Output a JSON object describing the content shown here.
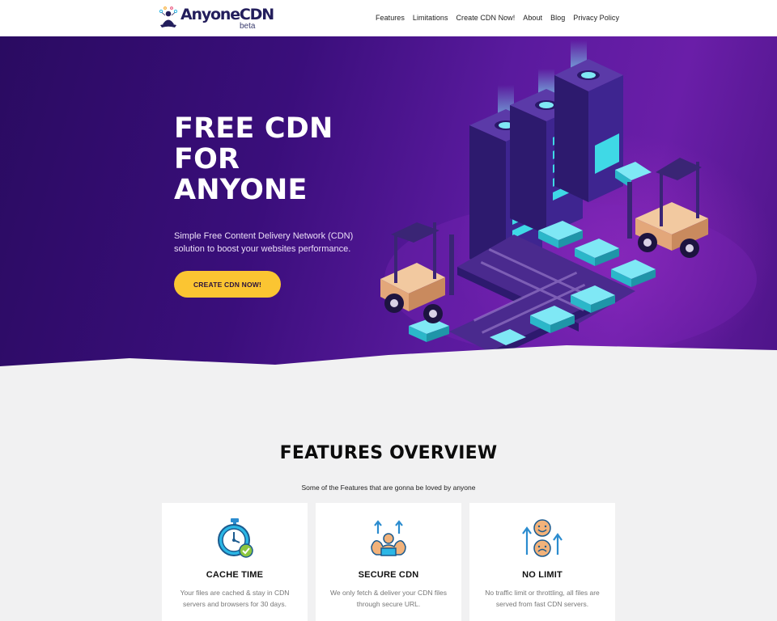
{
  "header": {
    "brand": "AnyoneCDN",
    "brand_tag": "beta",
    "nav": [
      "Features",
      "Limitations",
      "Create CDN Now!",
      "About",
      "Blog",
      "Privacy Policy"
    ]
  },
  "hero": {
    "title_lines": [
      "FREE CDN",
      "FOR",
      "ANYONE"
    ],
    "subtitle": "Simple Free Content Delivery Network (CDN) solution to boost your websites performance.",
    "cta": "CREATE CDN NOW!"
  },
  "features": {
    "title": "FEATURES OVERVIEW",
    "subtitle": "Some of the Features that are gonna be loved by anyone",
    "cards": [
      {
        "icon": "stopwatch-icon",
        "title": "CACHE TIME",
        "desc": "Your files are cached & stay in CDN servers and browsers for 30 days."
      },
      {
        "icon": "strong-person-icon",
        "title": "SECURE CDN",
        "desc": "We only fetch & deliver your CDN files through secure URL."
      },
      {
        "icon": "no-limit-icon",
        "title": "NO LIMIT",
        "desc": "No traffic limit or throttling, all files are served from fast CDN servers."
      }
    ]
  },
  "colors": {
    "brand_navy": "#231e5c",
    "hero_purple": "#3a0e7b",
    "cta_yellow": "#fbc532",
    "cyan": "#3fd9e6",
    "page_bg": "#f1f1f2"
  }
}
